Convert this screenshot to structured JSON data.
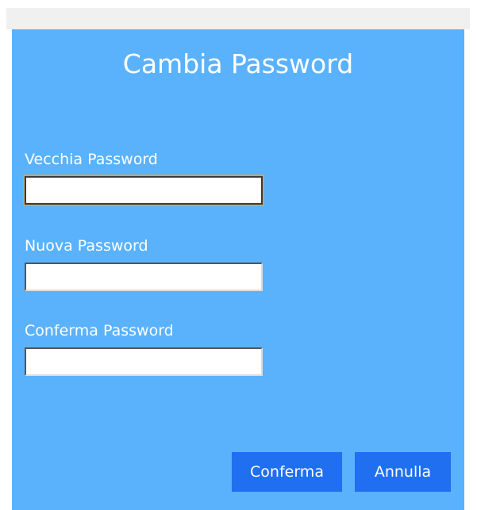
{
  "dialog": {
    "title": "Cambia Password",
    "fields": [
      {
        "label": "Vecchia Password",
        "value": "",
        "placeholder": ""
      },
      {
        "label": "Nuova Password",
        "value": "",
        "placeholder": ""
      },
      {
        "label": "Conferma Password",
        "value": "",
        "placeholder": ""
      }
    ],
    "buttons": {
      "confirm_label": "Conferma",
      "cancel_label": "Annulla"
    },
    "colors": {
      "background": "#5ab2fd",
      "button": "#1f6ff0",
      "text": "#ffffff",
      "focus_ring": "#c5a468"
    }
  }
}
